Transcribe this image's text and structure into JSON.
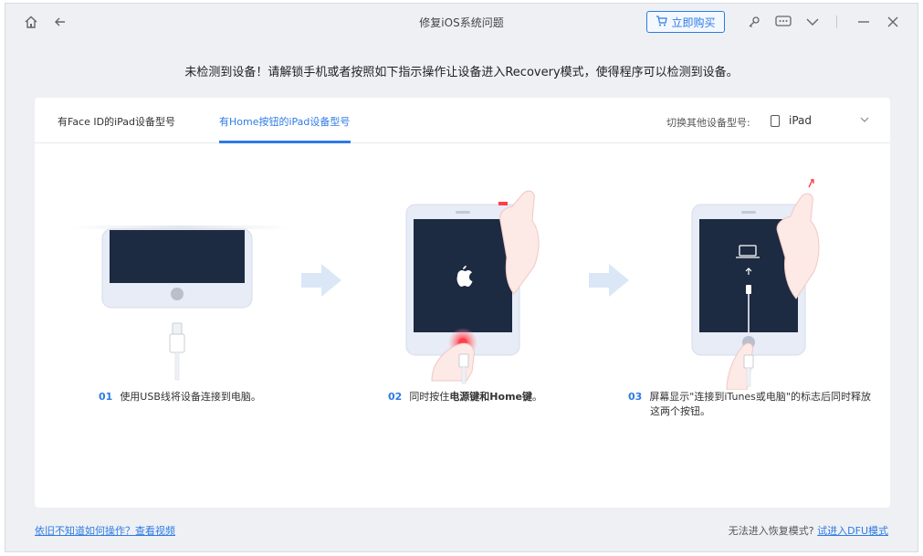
{
  "titlebar": {
    "title": "修复iOS系统问题",
    "buy_label": "立即购买",
    "icons": [
      "home-icon",
      "back-arrow-icon",
      "cart-icon",
      "key-icon",
      "feedback-icon",
      "chevron-down-icon",
      "minimize-icon",
      "close-icon"
    ]
  },
  "notice": "未检测到设备！请解锁手机或者按照如下指示操作让设备进入Recovery模式，使得程序可以检测到设备。",
  "tabs": [
    {
      "label": "有Face ID的iPad设备型号",
      "active": false
    },
    {
      "label": "有Home按钮的iPad设备型号",
      "active": true
    }
  ],
  "device_switch": {
    "label": "切换其他设备型号:",
    "value": "iPad"
  },
  "steps": [
    {
      "num": "01",
      "text": "使用USB线将设备连接到电脑。"
    },
    {
      "num": "02",
      "text_pre": "同时按住",
      "text_bold": "电源键和Home键",
      "text_post": "。"
    },
    {
      "num": "03",
      "line1": "屏幕显示\"连接到iTunes或电脑\"的标志后同时释放",
      "line2": "这两个按钮。"
    }
  ],
  "footer": {
    "help_link": "依旧不知道如何操作？查看视频",
    "dfu_prefix": "无法进入恢复模式?",
    "dfu_link": "试进入DFU模式"
  },
  "colors": {
    "accent": "#2d7be5",
    "screen": "#1c2a42",
    "device_frame": "#e7ecf6",
    "arrow": "#dbe7f7"
  }
}
